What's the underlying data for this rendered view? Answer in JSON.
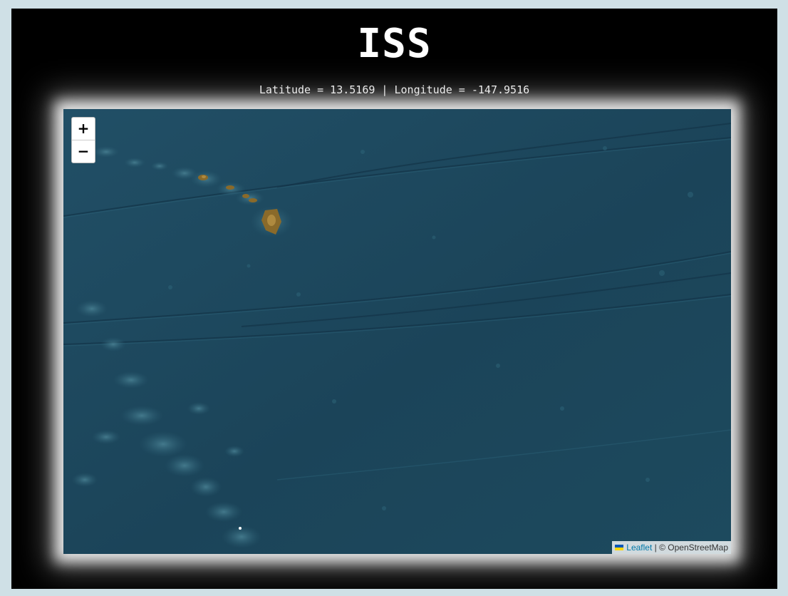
{
  "header": {
    "title": "ISS",
    "coordinates_text": "Latitude = 13.5169 | Longitude = -147.9516"
  },
  "map": {
    "zoom_in_label": "+",
    "zoom_out_label": "−",
    "attribution": {
      "leaflet_link": "Leaflet",
      "separator": " | ",
      "osm_text": "© OpenStreetMap"
    },
    "flag_colors": [
      "#0057b7",
      "#ffd700"
    ],
    "ocean_color": "#1e4a60",
    "land_color": "#8a6a2a"
  }
}
